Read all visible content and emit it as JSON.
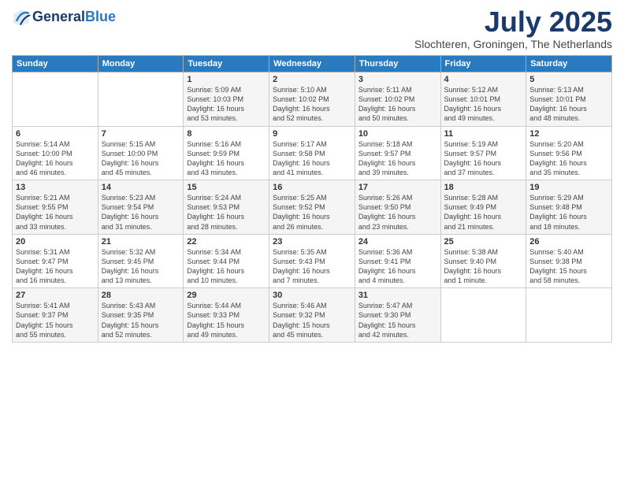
{
  "header": {
    "logo_line1": "General",
    "logo_line2": "Blue",
    "title": "July 2025",
    "location": "Slochteren, Groningen, The Netherlands"
  },
  "days_of_week": [
    "Sunday",
    "Monday",
    "Tuesday",
    "Wednesday",
    "Thursday",
    "Friday",
    "Saturday"
  ],
  "weeks": [
    [
      {
        "num": "",
        "info": ""
      },
      {
        "num": "",
        "info": ""
      },
      {
        "num": "1",
        "info": "Sunrise: 5:09 AM\nSunset: 10:03 PM\nDaylight: 16 hours\nand 53 minutes."
      },
      {
        "num": "2",
        "info": "Sunrise: 5:10 AM\nSunset: 10:02 PM\nDaylight: 16 hours\nand 52 minutes."
      },
      {
        "num": "3",
        "info": "Sunrise: 5:11 AM\nSunset: 10:02 PM\nDaylight: 16 hours\nand 50 minutes."
      },
      {
        "num": "4",
        "info": "Sunrise: 5:12 AM\nSunset: 10:01 PM\nDaylight: 16 hours\nand 49 minutes."
      },
      {
        "num": "5",
        "info": "Sunrise: 5:13 AM\nSunset: 10:01 PM\nDaylight: 16 hours\nand 48 minutes."
      }
    ],
    [
      {
        "num": "6",
        "info": "Sunrise: 5:14 AM\nSunset: 10:00 PM\nDaylight: 16 hours\nand 46 minutes."
      },
      {
        "num": "7",
        "info": "Sunrise: 5:15 AM\nSunset: 10:00 PM\nDaylight: 16 hours\nand 45 minutes."
      },
      {
        "num": "8",
        "info": "Sunrise: 5:16 AM\nSunset: 9:59 PM\nDaylight: 16 hours\nand 43 minutes."
      },
      {
        "num": "9",
        "info": "Sunrise: 5:17 AM\nSunset: 9:58 PM\nDaylight: 16 hours\nand 41 minutes."
      },
      {
        "num": "10",
        "info": "Sunrise: 5:18 AM\nSunset: 9:57 PM\nDaylight: 16 hours\nand 39 minutes."
      },
      {
        "num": "11",
        "info": "Sunrise: 5:19 AM\nSunset: 9:57 PM\nDaylight: 16 hours\nand 37 minutes."
      },
      {
        "num": "12",
        "info": "Sunrise: 5:20 AM\nSunset: 9:56 PM\nDaylight: 16 hours\nand 35 minutes."
      }
    ],
    [
      {
        "num": "13",
        "info": "Sunrise: 5:21 AM\nSunset: 9:55 PM\nDaylight: 16 hours\nand 33 minutes."
      },
      {
        "num": "14",
        "info": "Sunrise: 5:23 AM\nSunset: 9:54 PM\nDaylight: 16 hours\nand 31 minutes."
      },
      {
        "num": "15",
        "info": "Sunrise: 5:24 AM\nSunset: 9:53 PM\nDaylight: 16 hours\nand 28 minutes."
      },
      {
        "num": "16",
        "info": "Sunrise: 5:25 AM\nSunset: 9:52 PM\nDaylight: 16 hours\nand 26 minutes."
      },
      {
        "num": "17",
        "info": "Sunrise: 5:26 AM\nSunset: 9:50 PM\nDaylight: 16 hours\nand 23 minutes."
      },
      {
        "num": "18",
        "info": "Sunrise: 5:28 AM\nSunset: 9:49 PM\nDaylight: 16 hours\nand 21 minutes."
      },
      {
        "num": "19",
        "info": "Sunrise: 5:29 AM\nSunset: 9:48 PM\nDaylight: 16 hours\nand 18 minutes."
      }
    ],
    [
      {
        "num": "20",
        "info": "Sunrise: 5:31 AM\nSunset: 9:47 PM\nDaylight: 16 hours\nand 16 minutes."
      },
      {
        "num": "21",
        "info": "Sunrise: 5:32 AM\nSunset: 9:45 PM\nDaylight: 16 hours\nand 13 minutes."
      },
      {
        "num": "22",
        "info": "Sunrise: 5:34 AM\nSunset: 9:44 PM\nDaylight: 16 hours\nand 10 minutes."
      },
      {
        "num": "23",
        "info": "Sunrise: 5:35 AM\nSunset: 9:43 PM\nDaylight: 16 hours\nand 7 minutes."
      },
      {
        "num": "24",
        "info": "Sunrise: 5:36 AM\nSunset: 9:41 PM\nDaylight: 16 hours\nand 4 minutes."
      },
      {
        "num": "25",
        "info": "Sunrise: 5:38 AM\nSunset: 9:40 PM\nDaylight: 16 hours\nand 1 minute."
      },
      {
        "num": "26",
        "info": "Sunrise: 5:40 AM\nSunset: 9:38 PM\nDaylight: 15 hours\nand 58 minutes."
      }
    ],
    [
      {
        "num": "27",
        "info": "Sunrise: 5:41 AM\nSunset: 9:37 PM\nDaylight: 15 hours\nand 55 minutes."
      },
      {
        "num": "28",
        "info": "Sunrise: 5:43 AM\nSunset: 9:35 PM\nDaylight: 15 hours\nand 52 minutes."
      },
      {
        "num": "29",
        "info": "Sunrise: 5:44 AM\nSunset: 9:33 PM\nDaylight: 15 hours\nand 49 minutes."
      },
      {
        "num": "30",
        "info": "Sunrise: 5:46 AM\nSunset: 9:32 PM\nDaylight: 15 hours\nand 45 minutes."
      },
      {
        "num": "31",
        "info": "Sunrise: 5:47 AM\nSunset: 9:30 PM\nDaylight: 15 hours\nand 42 minutes."
      },
      {
        "num": "",
        "info": ""
      },
      {
        "num": "",
        "info": ""
      }
    ]
  ]
}
